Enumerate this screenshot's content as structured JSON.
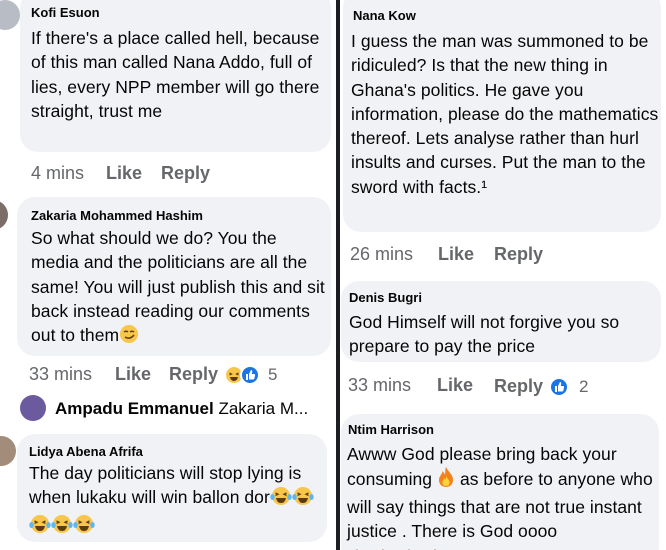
{
  "left_column": {
    "comments": [
      {
        "author": "Kofi Esuon",
        "text": "If there's a place called hell, because of this man called Nana Addo, full of lies, every NPP member will go there straight, trust me",
        "time": "4 mins",
        "like_label": "Like",
        "reply_label": "Reply"
      },
      {
        "author": "Zakaria Mohammed Hashim",
        "text": "So what should we do? You the media and the politicians are all the same! You will just publish this and sit back instead reading our comments out to them",
        "time": "33 mins",
        "like_label": "Like",
        "reply_label": "Reply",
        "reaction_count": "5"
      },
      {
        "author": "Lidya Abena Afrifa",
        "text": "The day politicians will stop lying is when lukaku will win ballon dor",
        "emoji_count": 5
      }
    ],
    "reply_preview": {
      "author": "Ampadu Emmanuel",
      "snippet": "Zakaria M..."
    }
  },
  "right_column": {
    "comments": [
      {
        "author": "Nana Kow",
        "text": "I guess the man was summoned to be ridiculed? Is that the new thing in Ghana's politics. He gave you information, please do the mathematics thereof.  Lets analyse rather than hurl insults and curses. Put the man to the sword with facts.¹",
        "time": "26 mins",
        "like_label": "Like",
        "reply_label": "Reply"
      },
      {
        "author": "Denis Bugri",
        "text": "God Himself will not forgive you so prepare to pay the price",
        "time": "33 mins",
        "like_label": "Like",
        "reply_label": "Reply",
        "reaction_count": "2"
      },
      {
        "author": "Ntim Harrison",
        "text_before_emoji": "Awww God please bring back your consuming",
        "text_after_emoji": "as before to anyone who will say things that are not true instant justice . There is God oooo"
      }
    ]
  },
  "colors": {
    "bubble": "#f0f2f5",
    "meta_text": "#65676b",
    "like_blue": "#1b74e4",
    "divider": "#1c1e21"
  },
  "icons": [
    "like-reaction-icon",
    "haha-reaction-icon",
    "smirk-emoji-icon",
    "laughing-tears-emoji-icon",
    "fire-emoji-icon",
    "pray-emoji-icon"
  ]
}
